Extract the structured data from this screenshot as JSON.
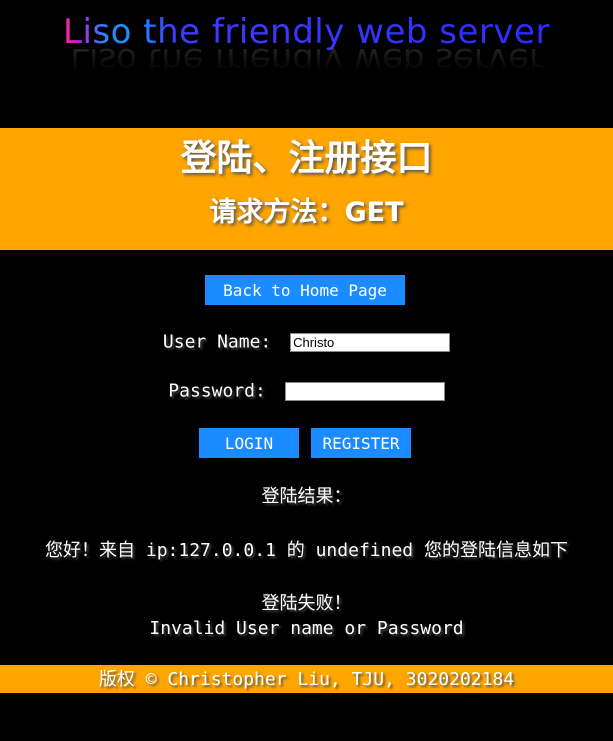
{
  "header": {
    "logo_text": "Liso the friendly web server"
  },
  "banner": {
    "title": "登陆、注册接口",
    "method": "请求方法：GET"
  },
  "nav": {
    "home_label": "Back to Home Page"
  },
  "form": {
    "username_label": "User Name:",
    "username_value": "Christo",
    "password_label": "Password:",
    "password_value": "",
    "login_label": "LOGIN",
    "register_label": "REGISTER"
  },
  "result": {
    "heading": "登陆结果：",
    "greeting_prefix": "您好！来自",
    "ip": "ip:127.0.0.1",
    "of": "的",
    "user": "undefined",
    "greeting_suffix": "您的登陆信息如下",
    "status": "登陆失败！",
    "message": "Invalid User name or Password"
  },
  "footer": {
    "copyright_word": "版权",
    "copyright_text": "© Christopher Liu, TJU, 3020202184"
  },
  "colors": {
    "banner_bg": "#ffa500",
    "button_bg": "#1a8cff",
    "page_bg": "#000000"
  }
}
